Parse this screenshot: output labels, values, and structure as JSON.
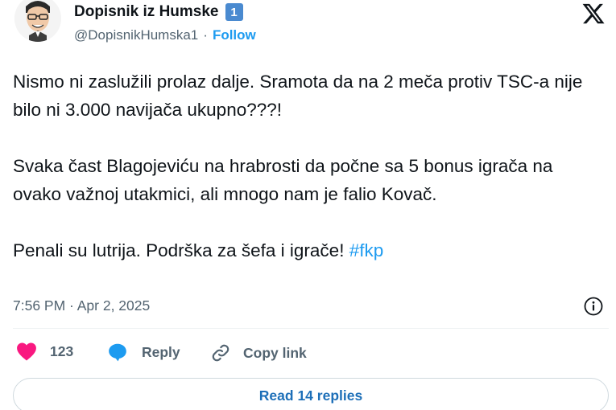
{
  "author": {
    "display_name": "Dopisnik iz Humske",
    "badge": "1",
    "handle": "@DopisnikHumska1",
    "separator": "·",
    "follow_label": "Follow",
    "avatar": "caricature-avatar"
  },
  "brand": {
    "logo_icon": "x-logo-icon"
  },
  "tweet": {
    "paragraphs": [
      "Nismo ni zaslužili prolaz dalje. Sramota da na 2 meča protiv TSC-a nije bilo ni 3.000 navijača ukupno???!",
      "Svaka čast Blagojeviću na hrabrosti da počne sa 5 bonus igrača na ovako važnoj utakmici, ali mnogo nam je falio Kovač.",
      "Penali su lutrija. Podrška za šefa i igrače! "
    ],
    "hashtag": "#fkp"
  },
  "meta": {
    "timestamp": "7:56 PM · Apr 2, 2025",
    "info_icon": "info-icon"
  },
  "actions": {
    "like_count": "123",
    "reply_label": "Reply",
    "copy_link_label": "Copy link"
  },
  "read_replies_label": "Read 14 replies",
  "colors": {
    "link_blue": "#1d9bf0",
    "like_pink": "#f91880",
    "text_primary": "#0f1419",
    "text_secondary": "#536471",
    "badge_blue": "#4a8ad0"
  }
}
